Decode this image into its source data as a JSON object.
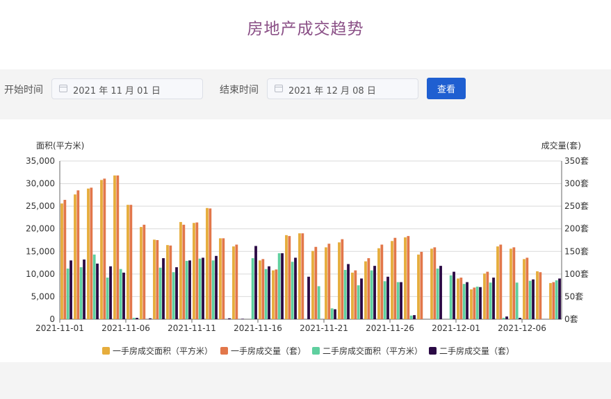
{
  "page": {
    "title": "房地产成交趋势"
  },
  "filters": {
    "start_label": "开始时间",
    "start_value": "2021 年 11 月 01 日",
    "end_label": "结束时间",
    "end_value": "2021 年 12 月 08 日",
    "query_button": "查看",
    "button_color": "#1f5fd1"
  },
  "chart_data": {
    "type": "bar",
    "title": "",
    "ylabel": "面积(平方米)",
    "y2label": "成交量(套)",
    "ylim": [
      0,
      35000
    ],
    "y2lim": [
      0,
      350
    ],
    "yticks": [
      "0",
      "5,000",
      "10,000",
      "15,000",
      "20,000",
      "25,000",
      "30,000",
      "35,000"
    ],
    "y2ticks": [
      "0套",
      "50套",
      "100套",
      "150套",
      "200套",
      "250套",
      "300套",
      "350套"
    ],
    "grid": true,
    "legend_position": "bottom",
    "categories": [
      "2021-11-01",
      "2021-11-02",
      "2021-11-03",
      "2021-11-04",
      "2021-11-05",
      "2021-11-06",
      "2021-11-07",
      "2021-11-08",
      "2021-11-09",
      "2021-11-10",
      "2021-11-11",
      "2021-11-12",
      "2021-11-13",
      "2021-11-14",
      "2021-11-15",
      "2021-11-16",
      "2021-11-17",
      "2021-11-18",
      "2021-11-19",
      "2021-11-20",
      "2021-11-21",
      "2021-11-22",
      "2021-11-23",
      "2021-11-24",
      "2021-11-25",
      "2021-11-26",
      "2021-11-27",
      "2021-11-28",
      "2021-11-29",
      "2021-11-30",
      "2021-12-01",
      "2021-12-02",
      "2021-12-03",
      "2021-12-04",
      "2021-12-05",
      "2021-12-06",
      "2021-12-07",
      "2021-12-08"
    ],
    "xtick_labels": [
      "2021-11-01",
      "2021-11-06",
      "2021-11-11",
      "2021-11-16",
      "2021-11-21",
      "2021-11-26",
      "2021-12-01",
      "2021-12-06"
    ],
    "series": [
      {
        "name": "一手房成交面积（平方米）",
        "axis": "left",
        "color": "#e6ad3c",
        "values": [
          25600,
          27600,
          28900,
          30800,
          31800,
          25300,
          20400,
          17600,
          16400,
          21500,
          21300,
          24600,
          17900,
          16100,
          0,
          13000,
          10800,
          18600,
          19000,
          15100,
          15900,
          17000,
          10300,
          12800,
          15700,
          17300,
          18100,
          14300,
          15600,
          0,
          9000,
          6600,
          10100,
          16100,
          15600,
          13300,
          10600,
          8000
        ]
      },
      {
        "name": "一手房成交量（套）",
        "axis": "right",
        "color": "#e2774a",
        "values": [
          264,
          285,
          291,
          311,
          318,
          253,
          209,
          175,
          163,
          209,
          214,
          245,
          179,
          165,
          0,
          133,
          110,
          184,
          190,
          160,
          167,
          177,
          108,
          135,
          165,
          180,
          184,
          149,
          159,
          0,
          92,
          70,
          105,
          165,
          159,
          136,
          104,
          82
        ]
      },
      {
        "name": "二手房成交面积（平方米）",
        "axis": "left",
        "color": "#5fcf9f",
        "values": [
          11200,
          11500,
          14300,
          9200,
          11100,
          300,
          0,
          11400,
          10400,
          12900,
          13400,
          13000,
          0,
          0,
          13500,
          11100,
          14600,
          12700,
          0,
          7300,
          2400,
          10900,
          7500,
          10800,
          8400,
          8200,
          800,
          0,
          11200,
          9700,
          7800,
          7200,
          8100,
          300,
          8100,
          8500,
          0,
          8600
        ]
      },
      {
        "name": "二手房成交量（套）",
        "axis": "right",
        "color": "#2b0a45",
        "values": [
          130,
          132,
          123,
          117,
          103,
          3,
          2,
          135,
          115,
          130,
          136,
          140,
          2,
          1,
          162,
          117,
          146,
          136,
          94,
          0,
          22,
          122,
          90,
          118,
          94,
          82,
          9,
          0,
          118,
          105,
          82,
          71,
          92,
          6,
          3,
          88,
          0,
          90
        ]
      }
    ]
  }
}
